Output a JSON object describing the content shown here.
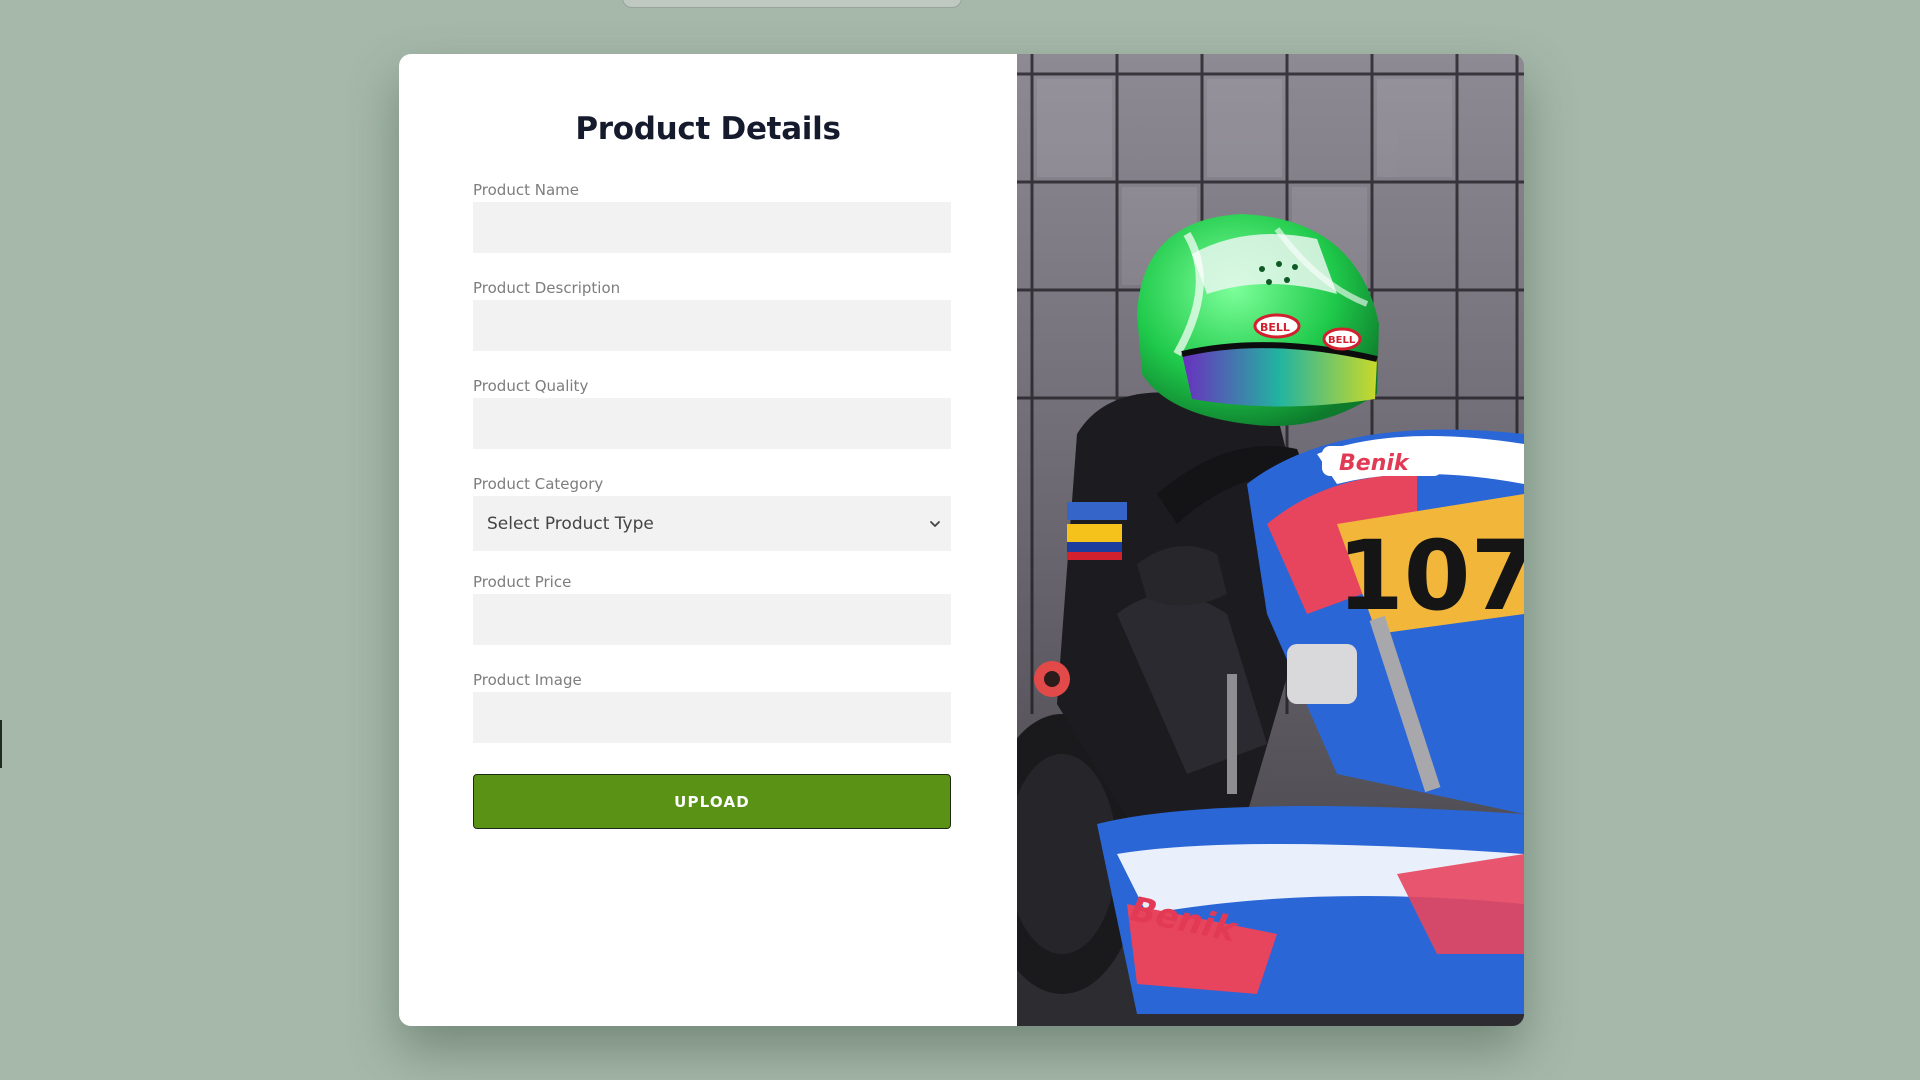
{
  "form": {
    "title": "Product Details",
    "fields": [
      {
        "label": "Product Name",
        "value": "",
        "placeholder": ""
      },
      {
        "label": "Product Description",
        "value": "",
        "placeholder": ""
      },
      {
        "label": "Product Quality",
        "value": "",
        "placeholder": ""
      },
      {
        "label": "Product Category",
        "selected": "Select Product Type"
      },
      {
        "label": "Product Price",
        "value": "",
        "placeholder": ""
      },
      {
        "label": "Product Image",
        "value": "",
        "placeholder": ""
      }
    ],
    "upload_label": "UPLOAD"
  },
  "hero_image": {
    "kart_number": "107",
    "brand": "Benik",
    "helmet_brand": "BELL"
  },
  "colors": {
    "background": "#a5b8aa",
    "button": "#5a9216",
    "input_bg": "#f2f2f2",
    "title": "#151a2c"
  }
}
